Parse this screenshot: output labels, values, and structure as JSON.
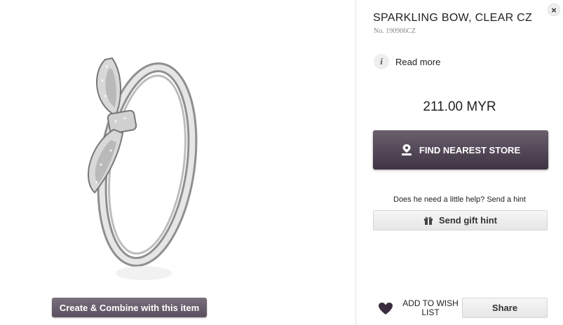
{
  "product": {
    "title": "SPARKLING BOW, CLEAR CZ",
    "number": "No. 190906CZ",
    "read_more": "Read more",
    "price": "211.00 MYR"
  },
  "actions": {
    "create_combine": "Create & Combine with this item",
    "find_store": "FIND NEAREST STORE",
    "hint_text": "Does he need a little help? Send a hint",
    "send_gift_hint": "Send gift hint",
    "add_to_wishlist": "ADD TO WISH LIST",
    "share": "Share",
    "close": "×"
  },
  "icons": {
    "info": "info-icon",
    "pin": "pin-icon",
    "gift": "gift-icon",
    "heart": "heart-icon",
    "close": "close-icon"
  },
  "colors": {
    "primary_button": "#4f4453",
    "secondary_button": "#eeeeee"
  }
}
